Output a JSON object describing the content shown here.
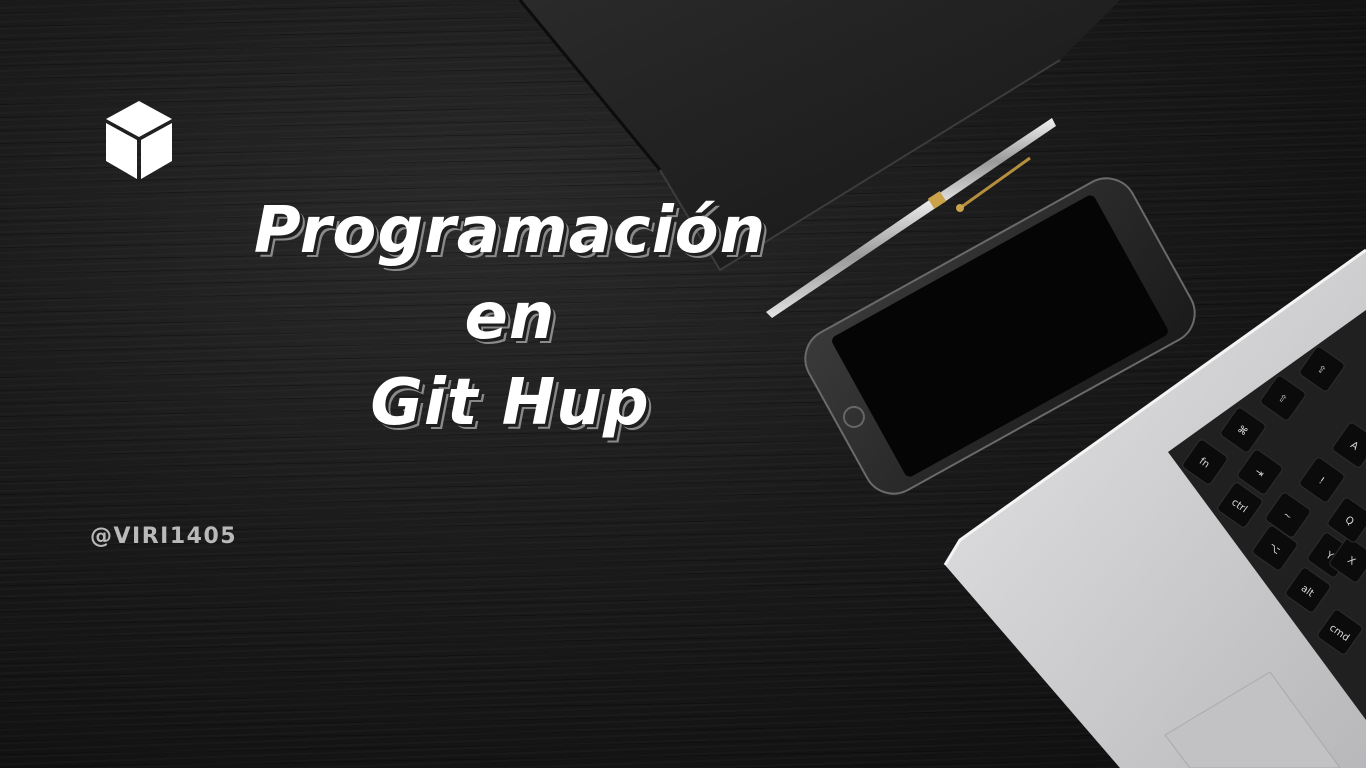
{
  "logo": {
    "icon": "cube-icon",
    "color": "#ffffff"
  },
  "title": {
    "line1": "Programación",
    "line2": "en",
    "line3": "Git Hup"
  },
  "handle": "@VIRI1405",
  "keyboard": {
    "keys": [
      "fn",
      "ctrl",
      "⌥",
      "alt",
      "cmd",
      "⌘",
      "⇧",
      "⇪",
      "⇥",
      "~",
      "!",
      "A",
      "Y",
      "X",
      "Q"
    ]
  },
  "colors": {
    "background": "#141414",
    "text": "#ffffff",
    "handle": "#b9b9b9",
    "laptop": "#cfcfd1"
  }
}
